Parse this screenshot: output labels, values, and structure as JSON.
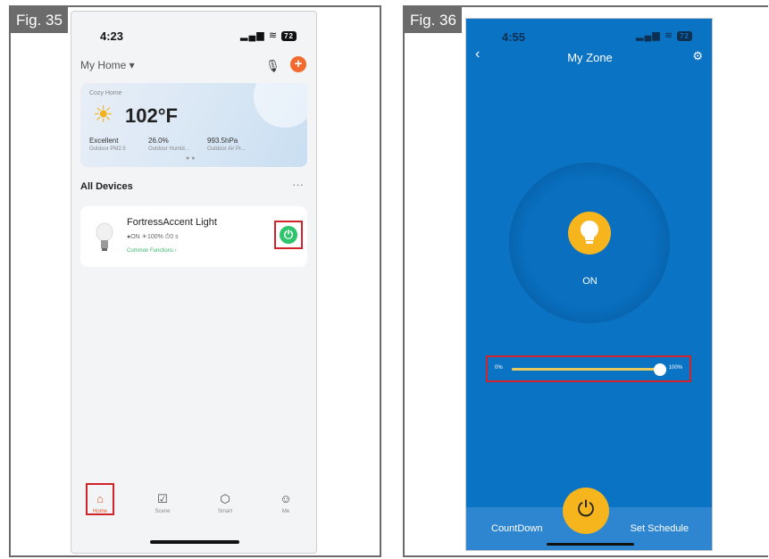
{
  "figures": {
    "left_label": "Fig. 35",
    "right_label": "Fig. 36"
  },
  "phone_a": {
    "status_time": "4:23",
    "battery": "72",
    "home_title": "My Home ▾",
    "weather": {
      "place": "Cozy Home",
      "temperature": "102°F",
      "stats": [
        {
          "value": "Excellent",
          "label": "Outdoor PM2.5"
        },
        {
          "value": "26.0%",
          "label": "Outdoor Humid..."
        },
        {
          "value": "993.5hPa",
          "label": "Outdoor Air Pr..."
        }
      ]
    },
    "section_title": "All Devices",
    "more": "···",
    "device": {
      "name": "FortressAccent Light",
      "meta": "●ON  ☀100%  ⏱0 s",
      "functions": "Common Functions ›"
    },
    "tabs": [
      {
        "label": "Home",
        "icon": "home-icon",
        "glyph": "⌂"
      },
      {
        "label": "Scene",
        "icon": "scene-icon",
        "glyph": "☑"
      },
      {
        "label": "Smart",
        "icon": "smart-icon",
        "glyph": "⬡"
      },
      {
        "label": "Me",
        "icon": "profile-icon",
        "glyph": "☺"
      }
    ]
  },
  "phone_b": {
    "status_time": "4:55",
    "battery": "72",
    "title": "My Zone",
    "state": "ON",
    "slider": {
      "min_label": "0%",
      "max_label": "100%",
      "value": 1.0
    },
    "countdown": "CountDown",
    "schedule": "Set Schedule"
  },
  "colors": {
    "accent_orange": "#f26a2e",
    "power_green": "#2ec46b",
    "zone_blue": "#0b73c4",
    "lamp_yellow": "#f6b51c",
    "highlight_red": "#d1232a"
  }
}
